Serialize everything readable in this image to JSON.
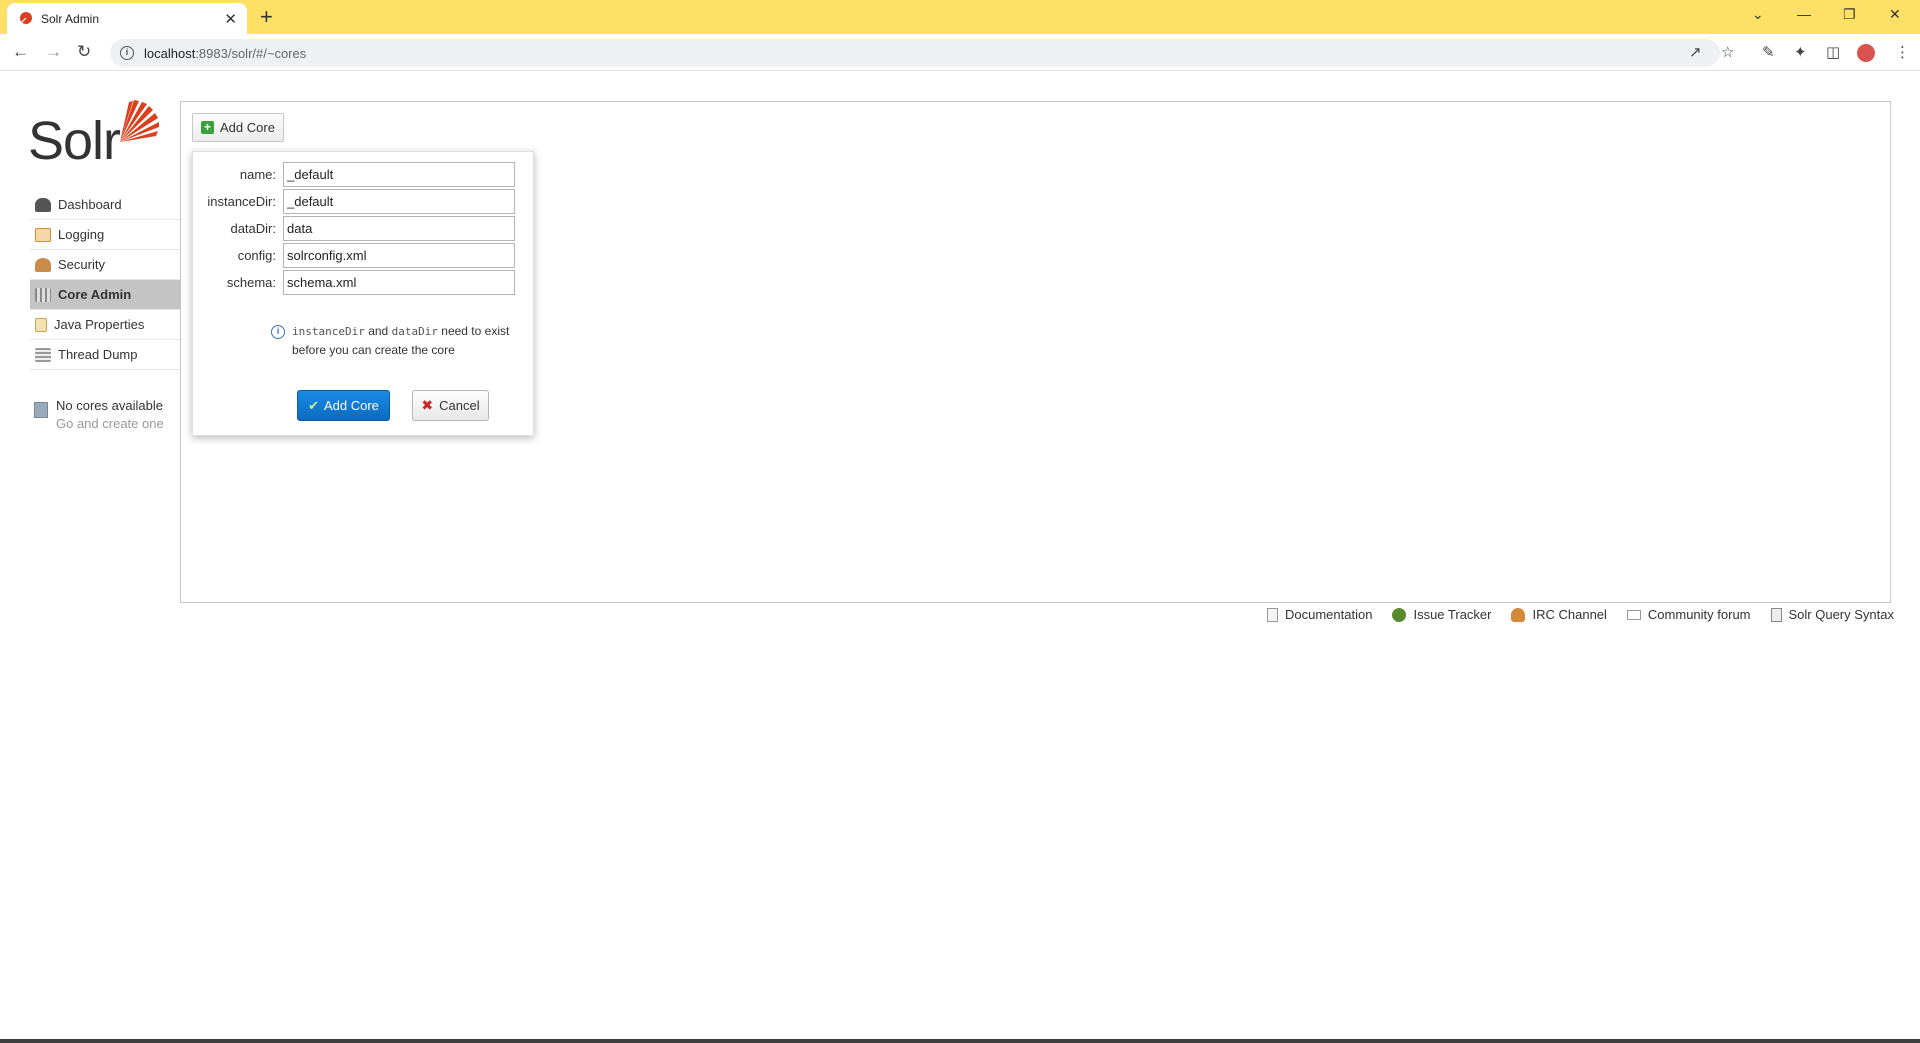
{
  "browser": {
    "tab_title": "Solr Admin",
    "tab_close": "✕",
    "new_tab": "+",
    "url_host": "localhost",
    "url_path": ":8983/solr/#/~cores",
    "controls": {
      "minimize": "—",
      "restore": "❐",
      "close": "✕",
      "tab_list": "⌄"
    }
  },
  "logo": {
    "text": "Solr"
  },
  "sidebar": {
    "items": [
      {
        "label": "Dashboard",
        "icon": "dashboard-icon",
        "color": "#555555"
      },
      {
        "label": "Logging",
        "icon": "logging-icon",
        "color": "#d98a2b"
      },
      {
        "label": "Security",
        "icon": "security-icon",
        "color": "#7a5a3a"
      },
      {
        "label": "Core Admin",
        "icon": "core-admin-icon",
        "color": "#8a8a8a",
        "active": true
      },
      {
        "label": "Java Properties",
        "icon": "java-properties-icon",
        "color": "#c9a44a"
      },
      {
        "label": "Thread Dump",
        "icon": "thread-dump-icon",
        "color": "#9a9a9a"
      }
    ],
    "cores": {
      "line1": "No cores available",
      "line2": "Go and create one"
    }
  },
  "main": {
    "toggle_button": "Add Core",
    "form": {
      "fields": [
        {
          "label": "name:",
          "value": "_default"
        },
        {
          "label": "instanceDir:",
          "value": "_default"
        },
        {
          "label": "dataDir:",
          "value": "data"
        },
        {
          "label": "config:",
          "value": "solrconfig.xml"
        },
        {
          "label": "schema:",
          "value": "schema.xml"
        }
      ],
      "note": {
        "code1": "instanceDir",
        "and": "and",
        "code2": "dataDir",
        "rest": "need to exist before you can create the core"
      },
      "submit_label": "Add Core",
      "cancel_label": "Cancel"
    }
  },
  "footer": {
    "links": [
      {
        "label": "Documentation",
        "icon": "document-icon"
      },
      {
        "label": "Issue Tracker",
        "icon": "bug-icon"
      },
      {
        "label": "IRC Channel",
        "icon": "irc-icon"
      },
      {
        "label": "Community forum",
        "icon": "mail-icon"
      },
      {
        "label": "Solr Query Syntax",
        "icon": "query-syntax-icon"
      }
    ]
  },
  "colors": {
    "tabbar": "#ffe066",
    "primary_button": "#0b6bbf",
    "logo_red": "#d9411e"
  }
}
